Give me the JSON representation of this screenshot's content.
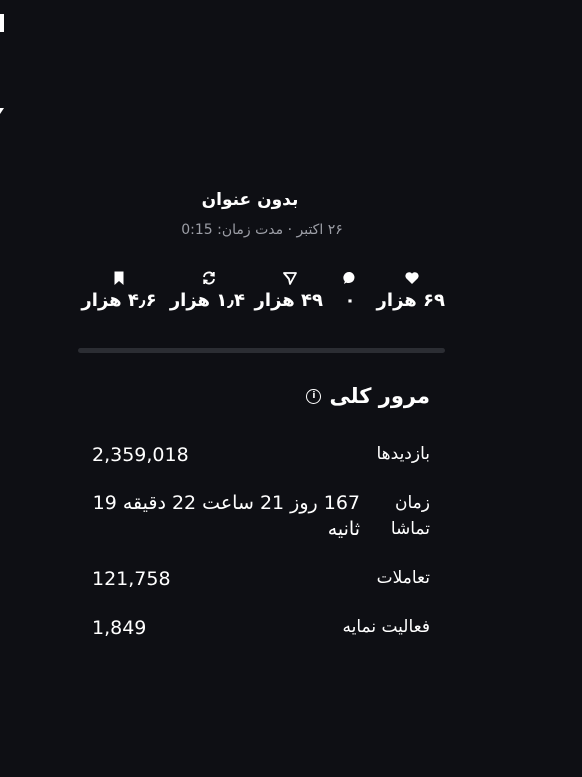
{
  "video": {
    "title": "بدون عنوان",
    "meta": "۲۶ اکتبر · مدت زمان: 0:15"
  },
  "stats": [
    {
      "icon": "heart-icon",
      "value": "۶۹ هزار"
    },
    {
      "icon": "comment-icon",
      "value": "۰"
    },
    {
      "icon": "share-icon",
      "value": "۴۹ هزار"
    },
    {
      "icon": "repost-icon",
      "value": "۱٫۴ هزار"
    },
    {
      "icon": "bookmark-icon",
      "value": "۴٫۶ هزار"
    }
  ],
  "overview": {
    "title": "مرور کلی",
    "info_glyph": "i",
    "metrics": [
      {
        "label": "بازدیدها",
        "value": "2,359,018"
      },
      {
        "label": "زمان تماشا",
        "value": "167 روز 21 ساعت 22 دقیقه 19 ثانیه"
      },
      {
        "label": "تعاملات",
        "value": "121,758"
      },
      {
        "label": "فعالیت نمایه",
        "value": "1,849"
      }
    ]
  },
  "colors": {
    "background": "#0e0f14",
    "text": "#ffffff",
    "muted": "#9c9ea6",
    "divider": "#2b2d33"
  }
}
